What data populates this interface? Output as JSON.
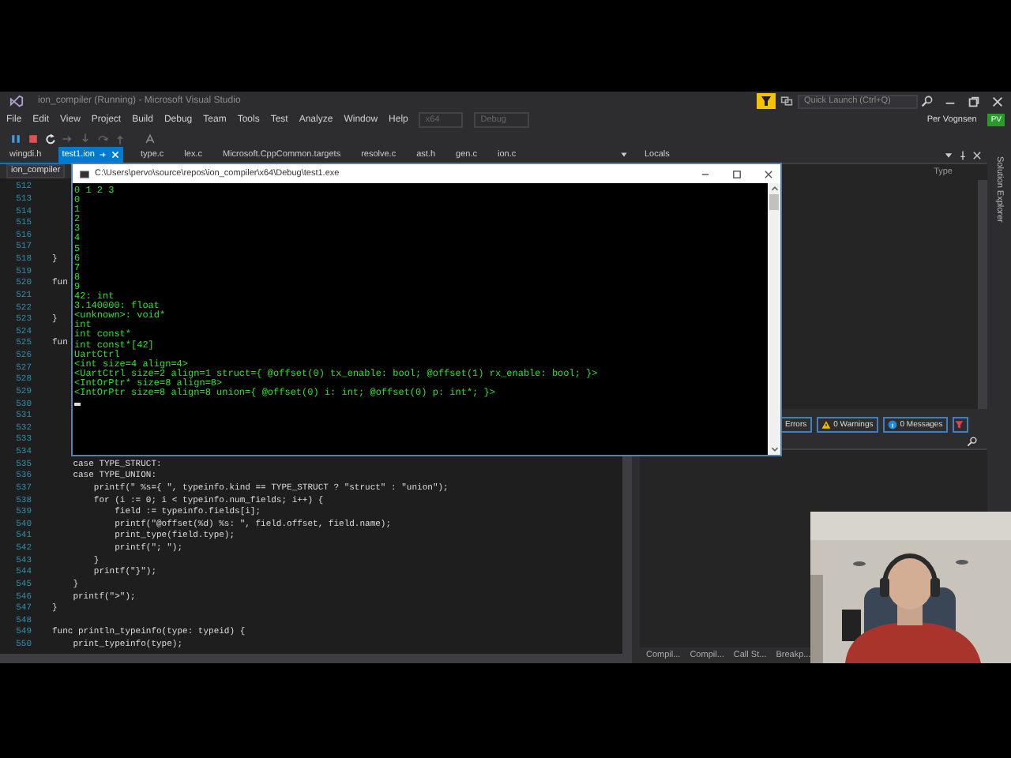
{
  "window": {
    "title": "ion_compiler (Running) - Microsoft Visual Studio"
  },
  "quick_launch": {
    "placeholder": "Quick Launch (Ctrl+Q)"
  },
  "menu": [
    "File",
    "Edit",
    "View",
    "Project",
    "Build",
    "Debug",
    "Team",
    "Tools",
    "Test",
    "Analyze",
    "Window",
    "Help"
  ],
  "config_dropdowns": [
    "x64",
    "Debug"
  ],
  "account": {
    "name": "Per Vognsen",
    "initials": "PV"
  },
  "tabs": [
    {
      "label": "wingdi.h",
      "selected": false
    },
    {
      "label": "test1.ion",
      "selected": true
    },
    {
      "label": "type.c",
      "selected": false
    },
    {
      "label": "lex.c",
      "selected": false
    },
    {
      "label": "Microsoft.CppCommon.targets",
      "selected": false
    },
    {
      "label": "resolve.c",
      "selected": false
    },
    {
      "label": "ast.h",
      "selected": false
    },
    {
      "label": "gen.c",
      "selected": false
    },
    {
      "label": "ion.c",
      "selected": false
    }
  ],
  "editor": {
    "project": "ion_compiler",
    "lines": [
      {
        "number": "512"
      },
      {
        "number": "513"
      },
      {
        "number": "514"
      },
      {
        "number": "515"
      },
      {
        "number": "516"
      },
      {
        "number": "517"
      },
      {
        "number": "518",
        "code": "}"
      },
      {
        "number": "519"
      },
      {
        "number": "520",
        "code": "fun"
      },
      {
        "number": "521"
      },
      {
        "number": "522"
      },
      {
        "number": "523",
        "code": "}"
      },
      {
        "number": "524"
      },
      {
        "number": "525",
        "code": "fun"
      },
      {
        "number": "526"
      },
      {
        "number": "527"
      },
      {
        "number": "528"
      },
      {
        "number": "529"
      },
      {
        "number": "530"
      },
      {
        "number": "531"
      },
      {
        "number": "532"
      },
      {
        "number": "533"
      },
      {
        "number": "534"
      },
      {
        "number": "535",
        "code": "    case TYPE_STRUCT:"
      },
      {
        "number": "536",
        "code": "    case TYPE_UNION:"
      },
      {
        "number": "537",
        "code": "        printf(\" %s={ \", typeinfo.kind == TYPE_STRUCT ? \"struct\" : \"union\");"
      },
      {
        "number": "538",
        "code": "        for (i := 0; i < typeinfo.num_fields; i++) {"
      },
      {
        "number": "539",
        "code": "            field := typeinfo.fields[i];"
      },
      {
        "number": "540",
        "code": "            printf(\"@offset(%d) %s: \", field.offset, field.name);"
      },
      {
        "number": "541",
        "code": "            print_type(field.type);"
      },
      {
        "number": "542",
        "code": "            printf(\"; \");"
      },
      {
        "number": "543",
        "code": "        }"
      },
      {
        "number": "544",
        "code": "        printf(\"}\");"
      },
      {
        "number": "545",
        "code": "    }"
      },
      {
        "number": "546",
        "code": "    printf(\">\");"
      },
      {
        "number": "547",
        "code": "}"
      },
      {
        "number": "548"
      },
      {
        "number": "549",
        "code": "func println_typeinfo(type: typeid) {"
      },
      {
        "number": "550",
        "code": "    print_typeinfo(type);"
      }
    ]
  },
  "console": {
    "title": "C:\\Users\\pervo\\source\\repos\\ion_compiler\\x64\\Debug\\test1.exe",
    "lines": [
      "0 1 2 3",
      "0",
      "1",
      "2",
      "3",
      "4",
      "5",
      "6",
      "7",
      "8",
      "9",
      "42: int",
      "3.140000: float",
      "<unknown>: void*",
      "int",
      "int const*",
      "int const*[42]",
      "UartCtrl",
      "<int size=4 align=4>",
      "<UartCtrl size=2 align=1 struct={ @offset(0) tx_enable: bool; @offset(1) rx_enable: bool; }>",
      "<IntOrPtr* size=8 align=8>",
      "<IntOrPtr size=8 align=8 union={ @offset(0) i: int; @offset(0) p: int*; }>"
    ]
  },
  "locals": {
    "title": "Locals",
    "columns": [
      "Type"
    ]
  },
  "error_list": {
    "filters": [
      {
        "label": "Errors"
      },
      {
        "label": "0 Warnings",
        "kind": "warning"
      },
      {
        "label": "0 Messages",
        "kind": "info"
      }
    ]
  },
  "bottom_tabs": [
    "Compil...",
    "Compil...",
    "Call St...",
    "Breakp..."
  ],
  "side_tab": "Solution Explorer",
  "webcam": {
    "kind": "picture"
  }
}
